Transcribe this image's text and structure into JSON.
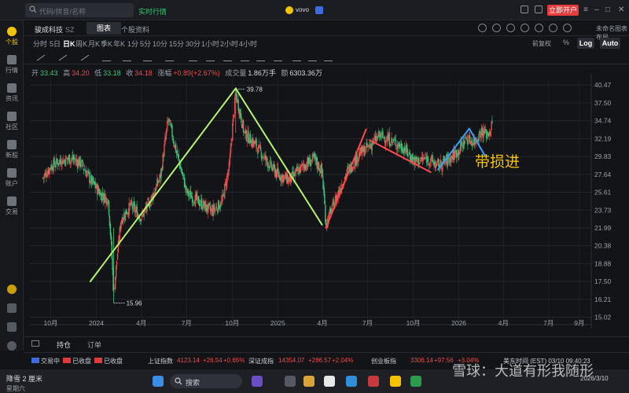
{
  "topbar": {
    "search_placeholder": "代码/拼音/名称",
    "realtime_label": "实时行情",
    "center_app": "vovo",
    "open_account_button": "立即开户"
  },
  "sidebar": {
    "items": [
      {
        "label": "个股",
        "icon": "stock-icon"
      },
      {
        "label": "行情",
        "icon": "market-icon"
      },
      {
        "label": "资讯",
        "icon": "news-icon"
      },
      {
        "label": "社区",
        "icon": "community-icon"
      },
      {
        "label": "新股",
        "icon": "ipo-icon"
      },
      {
        "label": "账户",
        "icon": "account-icon"
      },
      {
        "label": "交易",
        "icon": "trade-icon"
      }
    ]
  },
  "titlebar": {
    "stock_name": "骏成科技",
    "market": "SZ",
    "tab_chart": "图表",
    "tab_info": "个股资料",
    "unsaved_label": "未命名图表布局"
  },
  "periods": [
    "分时",
    "5日",
    "日K",
    "周K",
    "月K",
    "季K",
    "年K",
    "1分",
    "5分",
    "10分",
    "15分",
    "30分",
    "1小时",
    "2小时",
    "4小时"
  ],
  "active_period": "日K",
  "chart_controls": {
    "adjust": "前复权",
    "percent": "%",
    "log": "Log",
    "auto": "Auto"
  },
  "quote": {
    "open_label": "开",
    "open": "33.43",
    "high_label": "高",
    "high": "34.20",
    "low_label": "低",
    "low": "33.18",
    "close_label": "收",
    "close": "34.18",
    "change_label": "涨幅",
    "change": "+0.89(+2.67%)",
    "volume_label": "成交量",
    "volume": "1.86万手",
    "amount_label": "额",
    "amount": "6303.36万"
  },
  "chart_data": {
    "type": "candlestick",
    "y_axis_ticks": [
      40.47,
      37.5,
      34.74,
      32.19,
      29.83,
      27.64,
      25.61,
      23.73,
      21.99,
      20.38,
      18.88,
      17.5,
      16.21,
      15.02
    ],
    "y_scale": "log",
    "x_axis_ticks": [
      "10月",
      "2024",
      "4月",
      "7月",
      "10月",
      "2025",
      "4月",
      "7月",
      "10月",
      "2026",
      "4月",
      "7月",
      "9月"
    ],
    "annotations": {
      "high_marker": "39.78",
      "low_marker": "15.96",
      "note": "带损进"
    },
    "close_path": [
      [
        "2023-09-15",
        27.2
      ],
      [
        "2023-10-01",
        28.6
      ],
      [
        "2023-10-20",
        29.3
      ],
      [
        "2023-11-10",
        29.6
      ],
      [
        "2023-12-01",
        29.0
      ],
      [
        "2023-12-20",
        27.0
      ],
      [
        "2024-01-10",
        25.4
      ],
      [
        "2024-01-25",
        24.8
      ],
      [
        "2024-02-05",
        16.5
      ],
      [
        "2024-02-20",
        22.8
      ],
      [
        "2024-03-10",
        24.2
      ],
      [
        "2024-04-01",
        23.0
      ],
      [
        "2024-04-20",
        24.8
      ],
      [
        "2024-05-10",
        27.5
      ],
      [
        "2024-05-25",
        35.0
      ],
      [
        "2024-06-10",
        30.5
      ],
      [
        "2024-07-01",
        25.6
      ],
      [
        "2024-07-25",
        24.6
      ],
      [
        "2024-08-20",
        23.6
      ],
      [
        "2024-09-10",
        24.5
      ],
      [
        "2024-09-25",
        28.5
      ],
      [
        "2024-10-08",
        39.0
      ],
      [
        "2024-10-25",
        33.0
      ],
      [
        "2024-11-15",
        31.5
      ],
      [
        "2024-12-10",
        29.2
      ],
      [
        "2025-01-01",
        27.6
      ],
      [
        "2025-01-25",
        27.0
      ],
      [
        "2025-02-20",
        28.6
      ],
      [
        "2025-03-15",
        29.5
      ],
      [
        "2025-03-31",
        28.0
      ],
      [
        "2025-04-08",
        22.3
      ],
      [
        "2025-04-30",
        25.2
      ],
      [
        "2025-05-20",
        27.8
      ],
      [
        "2025-06-15",
        30.2
      ],
      [
        "2025-07-05",
        31.2
      ],
      [
        "2025-07-25",
        32.6
      ],
      [
        "2025-08-15",
        32.0
      ],
      [
        "2025-09-10",
        31.0
      ],
      [
        "2025-10-05",
        29.2
      ],
      [
        "2025-10-30",
        29.6
      ],
      [
        "2025-11-20",
        28.6
      ],
      [
        "2025-12-10",
        29.4
      ],
      [
        "2026-01-01",
        30.6
      ],
      [
        "2026-01-15",
        32.2
      ],
      [
        "2026-02-01",
        31.8
      ],
      [
        "2026-02-15",
        33.2
      ],
      [
        "2026-03-01",
        32.8
      ],
      [
        "2026-03-10",
        34.18
      ]
    ],
    "trend_lines": [
      {
        "color": "#b6f26b",
        "from": [
          "2023-12-20",
          17.5
        ],
        "to": [
          "2024-10-08",
          39.9
        ]
      },
      {
        "color": "#b6f26b",
        "from": [
          "2024-10-08",
          39.9
        ],
        "to": [
          "2025-03-31",
          22.3
        ]
      },
      {
        "color": "#ff4a4a",
        "from": [
          "2025-04-08",
          22.0
        ],
        "to": [
          "2025-06-28",
          33.5
        ]
      },
      {
        "color": "#ff4a4a",
        "from": [
          "2025-07-05",
          32.0
        ],
        "to": [
          "2025-11-05",
          27.9
        ]
      },
      {
        "color": "#3aa0ff",
        "from": [
          "2025-11-20",
          28.2
        ],
        "to": [
          "2026-01-22",
          33.6
        ]
      },
      {
        "color": "#3aa0ff",
        "from": [
          "2026-01-22",
          33.6
        ],
        "to": [
          "2026-02-22",
          30.0
        ]
      }
    ]
  },
  "bottom_tabs": {
    "positions": "持仓",
    "orders": "订单"
  },
  "ticker": {
    "us_status": "交易中",
    "hk_status": "已收盘",
    "cn_status": "已收盘",
    "sh_name": "上证指数",
    "sh_value": "4123.14",
    "sh_change": "+26.54",
    "sh_pct": "+0.65%",
    "sz_name": "深证成指",
    "sz_value": "14354.07",
    "sz_change": "+286.57",
    "sz_pct": "+2.04%",
    "cy_name": "创业板指",
    "cy_value": "3306.14",
    "cy_change": "+97.56",
    "cy_pct": "+3.04%",
    "time_label": "美东时间 (EST) 03/10 09:40:23"
  },
  "taskbar": {
    "weather_title": "降雪 2 厘米",
    "weather_sub": "星期六",
    "search_label": "搜索",
    "date": "2026/3/10"
  },
  "watermark": "雪球：大道有形我随形",
  "colors": {
    "up": "#e84c4c",
    "down": "#3ec47a",
    "accent": "#f5c400",
    "note": "#f5c400"
  }
}
